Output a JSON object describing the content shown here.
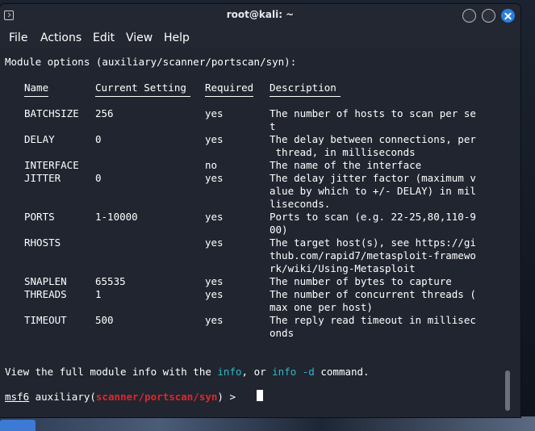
{
  "window": {
    "title": "root@kali: ~"
  },
  "menu": [
    "File",
    "Actions",
    "Edit",
    "View",
    "Help"
  ],
  "module_header": "Module options (auxiliary/scanner/portscan/syn):",
  "columns": [
    "Name",
    "Current Setting",
    "Required",
    "Description"
  ],
  "options": [
    {
      "name": "BATCHSIZE",
      "setting": "256",
      "required": "yes",
      "desc": [
        "The number of hosts to scan per se",
        "t"
      ]
    },
    {
      "name": "DELAY",
      "setting": "0",
      "required": "yes",
      "desc": [
        "The delay between connections, per",
        " thread, in milliseconds"
      ]
    },
    {
      "name": "INTERFACE",
      "setting": "",
      "required": "no",
      "desc": [
        "The name of the interface"
      ]
    },
    {
      "name": "JITTER",
      "setting": "0",
      "required": "yes",
      "desc": [
        "The delay jitter factor (maximum v",
        "alue by which to +/- DELAY) in mil",
        "liseconds."
      ]
    },
    {
      "name": "PORTS",
      "setting": "1-10000",
      "required": "yes",
      "desc": [
        "Ports to scan (e.g. 22-25,80,110-9",
        "00)"
      ]
    },
    {
      "name": "RHOSTS",
      "setting": "",
      "required": "yes",
      "desc": [
        "The target host(s), see https://gi",
        "thub.com/rapid7/metasploit-framewo",
        "rk/wiki/Using-Metasploit"
      ]
    },
    {
      "name": "SNAPLEN",
      "setting": "65535",
      "required": "yes",
      "desc": [
        "The number of bytes to capture"
      ]
    },
    {
      "name": "THREADS",
      "setting": "1",
      "required": "yes",
      "desc": [
        "The number of concurrent threads (",
        "max one per host)"
      ]
    },
    {
      "name": "TIMEOUT",
      "setting": "500",
      "required": "yes",
      "desc": [
        "The reply read timeout in millisec",
        "onds"
      ]
    }
  ],
  "footer": {
    "part1": "View the full module info with the ",
    "info": "info",
    "part2": ", or ",
    "info_d": "info -d",
    "part3": " command."
  },
  "prompt": {
    "user": "msf6",
    "prefix": " auxiliary(",
    "module": "scanner/portscan/syn",
    "suffix": ") > "
  },
  "colors": {
    "keyword": "#2fb9c9",
    "module": "#e0262b",
    "close_button": "#2a7fe0"
  }
}
